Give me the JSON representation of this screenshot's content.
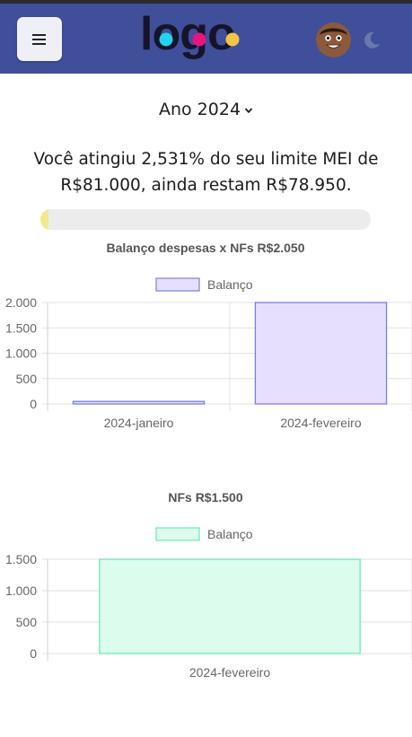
{
  "header": {
    "menu_icon": "hamburger-icon",
    "logo_text": "logo",
    "avatar_icon": "avatar-icon",
    "theme_icon": "moon-icon",
    "bg_color": "#3f4f9a"
  },
  "year_selector": {
    "label": "Ano 2024",
    "icon": "chevron-down-icon"
  },
  "limit": {
    "line1": "Você atingiu 2,531% do seu limite MEI de",
    "line2": "R$81.000, ainda restam R$78.950.",
    "progress_percent": 2.531,
    "bar_color": "#f2e98f"
  },
  "chart_data": [
    {
      "type": "bar",
      "title": "Balanço despesas x NFs R$2.050",
      "categories": [
        "2024-janeiro",
        "2024-fevereiro"
      ],
      "series": [
        {
          "name": "Balanço",
          "values": [
            50,
            2000
          ]
        }
      ],
      "ylim": [
        0,
        2000
      ],
      "yticks": [
        0,
        500,
        1000,
        1500,
        2000
      ],
      "ytick_labels": [
        "0",
        "500",
        "1.000",
        "1.500",
        "2.000"
      ],
      "legend": "top-center",
      "grid": true,
      "fill_color": "#e6dffd",
      "stroke_color": "#7a7ee6"
    },
    {
      "type": "bar",
      "title": "NFs R$1.500",
      "categories": [
        "2024-fevereiro"
      ],
      "series": [
        {
          "name": "Balanço",
          "values": [
            1500
          ]
        }
      ],
      "ylim": [
        0,
        1500
      ],
      "yticks": [
        0,
        500,
        1000,
        1500
      ],
      "ytick_labels": [
        "0",
        "500",
        "1.000",
        "1.500"
      ],
      "legend": "top-center",
      "grid": true,
      "fill_color": "#dcfdee",
      "stroke_color": "#6fe7b8"
    }
  ]
}
